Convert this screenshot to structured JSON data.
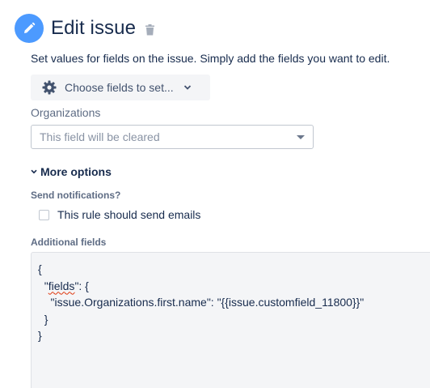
{
  "header": {
    "title": "Edit issue",
    "accent_color": "#4c9aff"
  },
  "description": "Set values for fields on the issue. Simply add the fields you want to edit.",
  "choose_fields": {
    "label": "Choose fields to set...",
    "icon": "gear-icon"
  },
  "organizations": {
    "label": "Organizations",
    "placeholder": "This field will be cleared"
  },
  "more_options": {
    "label": "More options"
  },
  "notifications": {
    "label": "Send notifications?",
    "checkbox_label": "This rule should send emails",
    "checked": false
  },
  "additional_fields": {
    "label": "Additional fields",
    "lines": {
      "l0": "{",
      "l1_pre": "  \"",
      "l1_key": "fields",
      "l1_post": "\": {",
      "l2": "    \"issue.Organizations.first.name\": \"{{issue.customfield_11800}}\"",
      "l3": "  }",
      "l4": "}"
    }
  }
}
